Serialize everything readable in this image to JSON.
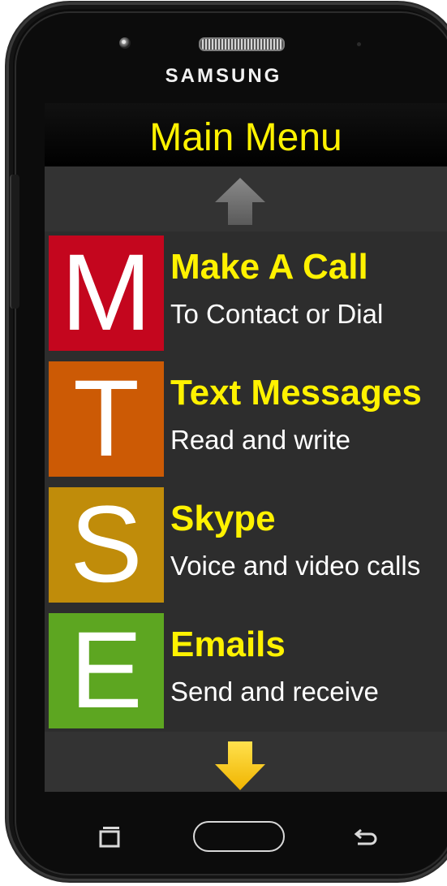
{
  "device": {
    "brand": "SAMSUNG"
  },
  "header": {
    "title": "Main Menu"
  },
  "navigation": {
    "up_icon": "up-arrow-icon",
    "down_icon": "down-arrow-icon"
  },
  "menu": {
    "items": [
      {
        "letter": "M",
        "title": "Make A Call",
        "subtitle": "To Contact or Dial",
        "color": "#c4061e"
      },
      {
        "letter": "T",
        "title": "Text Messages",
        "subtitle": "Read and write",
        "color": "#cc5a05"
      },
      {
        "letter": "S",
        "title": "Skype",
        "subtitle": "Voice and video calls",
        "color": "#c08c0a"
      },
      {
        "letter": "E",
        "title": "Emails",
        "subtitle": "Send and receive",
        "color": "#5da621"
      }
    ]
  },
  "system_nav": {
    "recent_icon": "recent-apps-icon",
    "home_icon": "home-button",
    "back_icon": "back-icon"
  },
  "colors": {
    "accent_text": "#fff200",
    "screen_bg": "#2b2b2b",
    "down_arrow": "#ffd21a",
    "up_arrow": "#6b6b6b"
  }
}
